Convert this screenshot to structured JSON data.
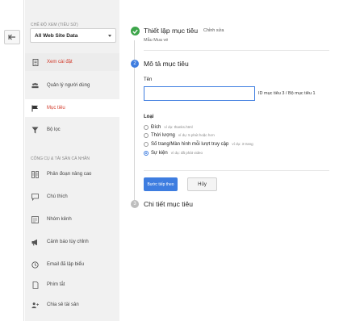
{
  "sidebar": {
    "view_label": "CHẾ ĐỘ XEM (TIÊU SỬ)",
    "view_selected": "All Web Site Data",
    "section_personal": "CÔNG CỤ & TÀI SẢN CÁ NHÂN",
    "items": [
      {
        "label": "Xem cài đặt",
        "icon": "document-icon"
      },
      {
        "label": "Quản lý người dùng",
        "icon": "users-icon"
      },
      {
        "label": "Mục tiêu",
        "icon": "flag-icon"
      },
      {
        "label": "Bộ lọc",
        "icon": "filter-icon"
      }
    ],
    "personal_items": [
      {
        "label": "Phân đoạn nâng cao",
        "icon": "segments-icon"
      },
      {
        "label": "Chú thích",
        "icon": "comment-icon"
      },
      {
        "label": "Nhóm kênh",
        "icon": "channel-group-icon"
      },
      {
        "label": "Cảnh báo tùy chỉnh",
        "icon": "megaphone-icon"
      },
      {
        "label": "Email đã lập biểu",
        "icon": "clock-icon"
      },
      {
        "label": "Phím tắt",
        "icon": "bookmark-icon"
      },
      {
        "label": "Chia sẻ tài sản",
        "icon": "share-user-icon"
      }
    ]
  },
  "steps": {
    "step1": {
      "title": "Thiết lập mục tiêu",
      "edit": "Chỉnh sửa",
      "subtitle": "Mẫu Mua vé"
    },
    "step2": {
      "number": "2",
      "title": "Mô tả mục tiêu"
    },
    "step3": {
      "number": "3",
      "title": "Chi tiết mục tiêu"
    }
  },
  "form": {
    "name_label": "Tên",
    "name_value": "",
    "goal_id": "ID mục tiêu 3 / Bộ mục tiêu 1",
    "type_label": "Loại",
    "types": [
      {
        "name": "Đích",
        "example": "ví dụ: thanks.html",
        "selected": false
      },
      {
        "name": "Thời lượng",
        "example": "ví dụ: 5 phút hoặc hơn",
        "selected": false
      },
      {
        "name": "Số trang/Màn hình mỗi lượt truy cập",
        "example": "ví dụ: 3 trang",
        "selected": false
      },
      {
        "name": "Sự kiện",
        "example": "ví dụ: đã phát video",
        "selected": true
      }
    ],
    "continue_label": "Bước tiếp theo",
    "cancel_label": "Hủy"
  },
  "colors": {
    "accent": "#3e7de0",
    "success": "#3da54a",
    "active_red": "#d23a2a",
    "step_inactive": "#bdbdbd"
  }
}
